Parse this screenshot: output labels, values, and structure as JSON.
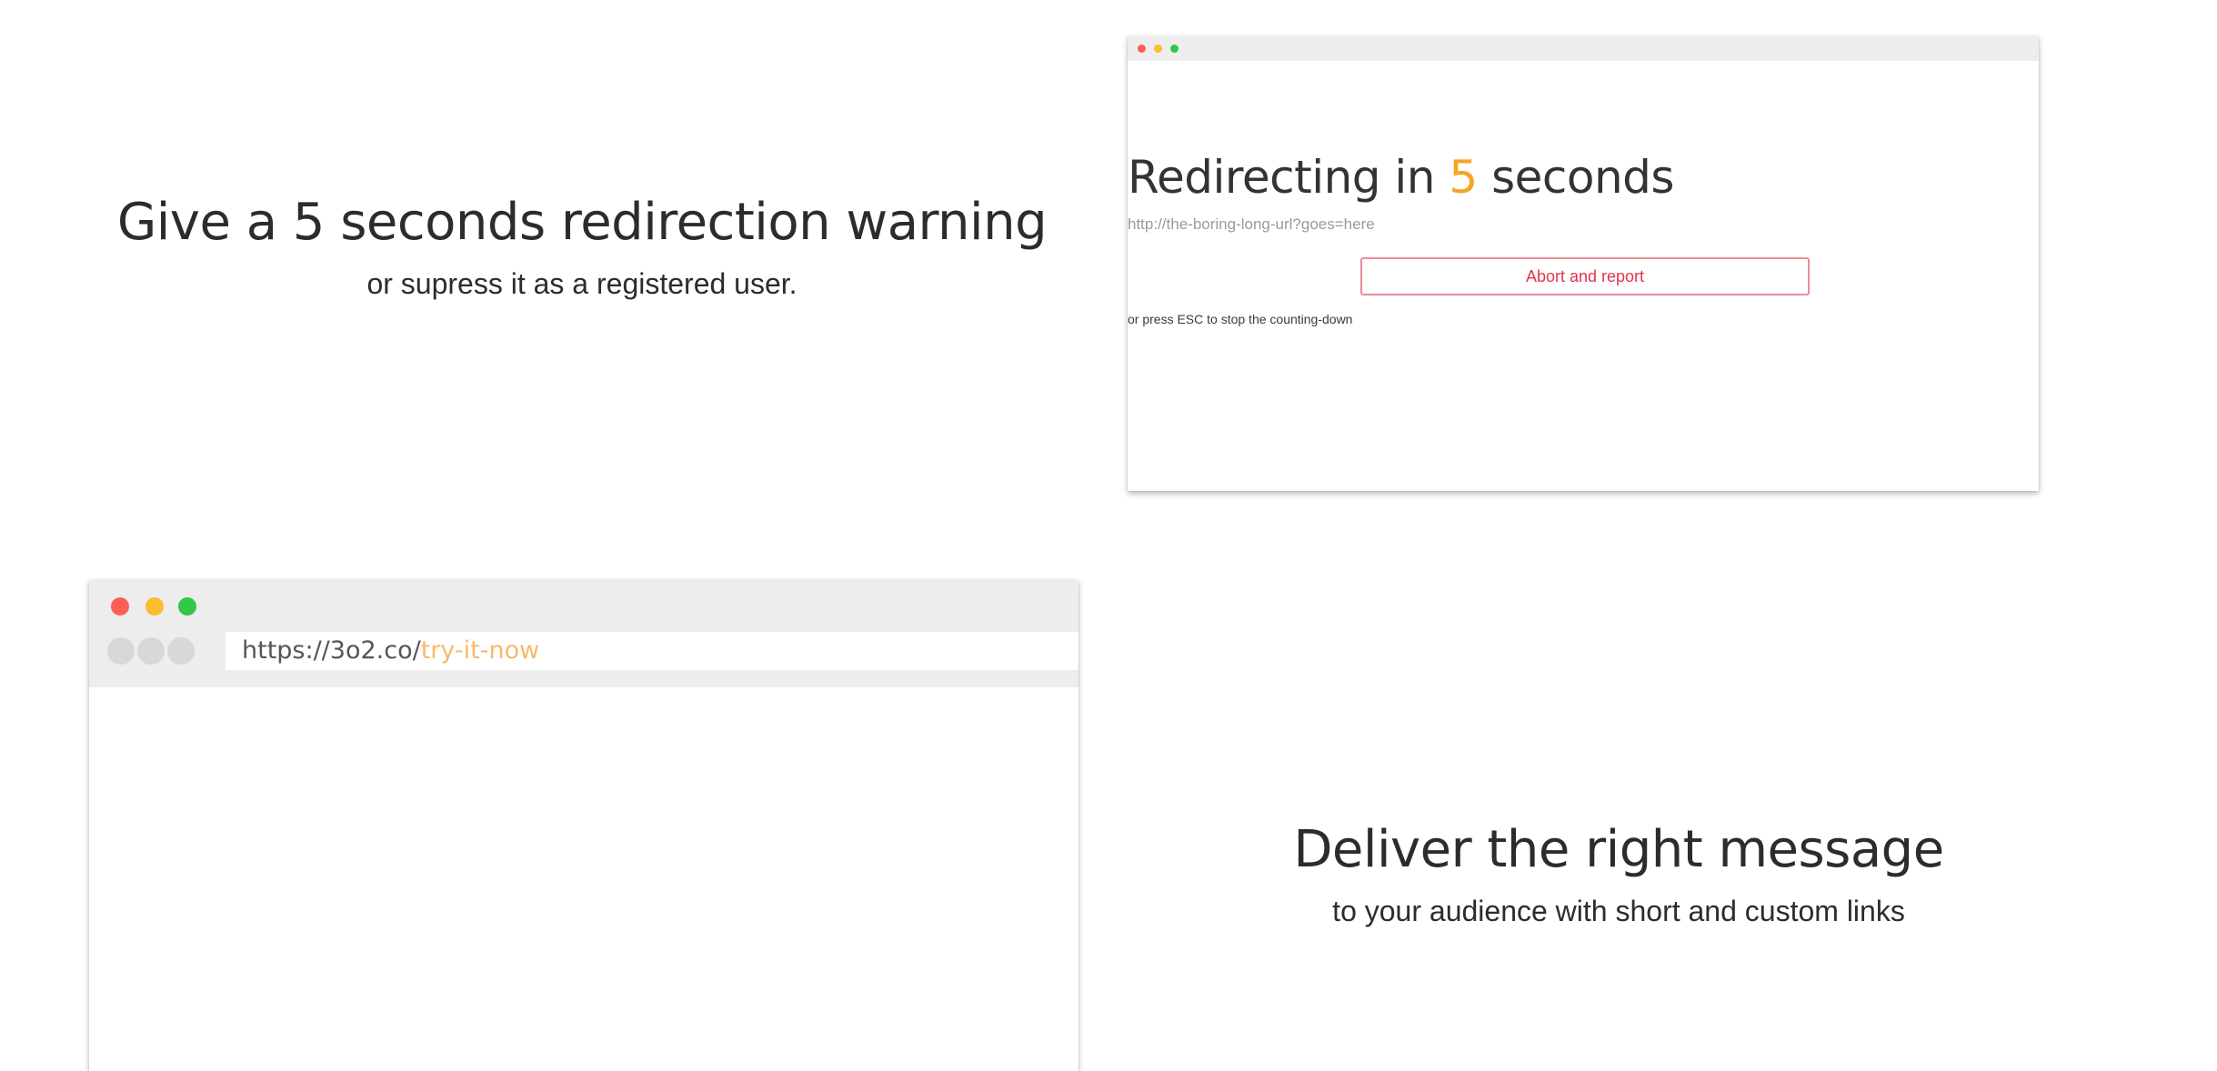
{
  "features": {
    "redirect_warning": {
      "title": "Give a 5 seconds redirection warning",
      "subtitle": "or supress it as a registered user."
    },
    "right_message": {
      "title": "Deliver the right message",
      "subtitle": "to your audience with short and custom links"
    }
  },
  "redirect_mock": {
    "heading_prefix": "Redirecting in ",
    "countdown": "5",
    "heading_suffix": " seconds",
    "target_url": "http://the-boring-long-url?goes=here",
    "abort_button_label": "Abort and report",
    "esc_hint": "or press ESC to stop the counting-down"
  },
  "url_mock": {
    "url_base": "https://3o2.co/",
    "url_slug": "try-it-now"
  },
  "colors": {
    "accent_orange": "#f5a623",
    "abort_red": "#e0344d",
    "slug_orange": "#f9b96a",
    "traffic_red": "#fc5f57",
    "traffic_yellow": "#fdbc2e",
    "traffic_green": "#33c748"
  }
}
